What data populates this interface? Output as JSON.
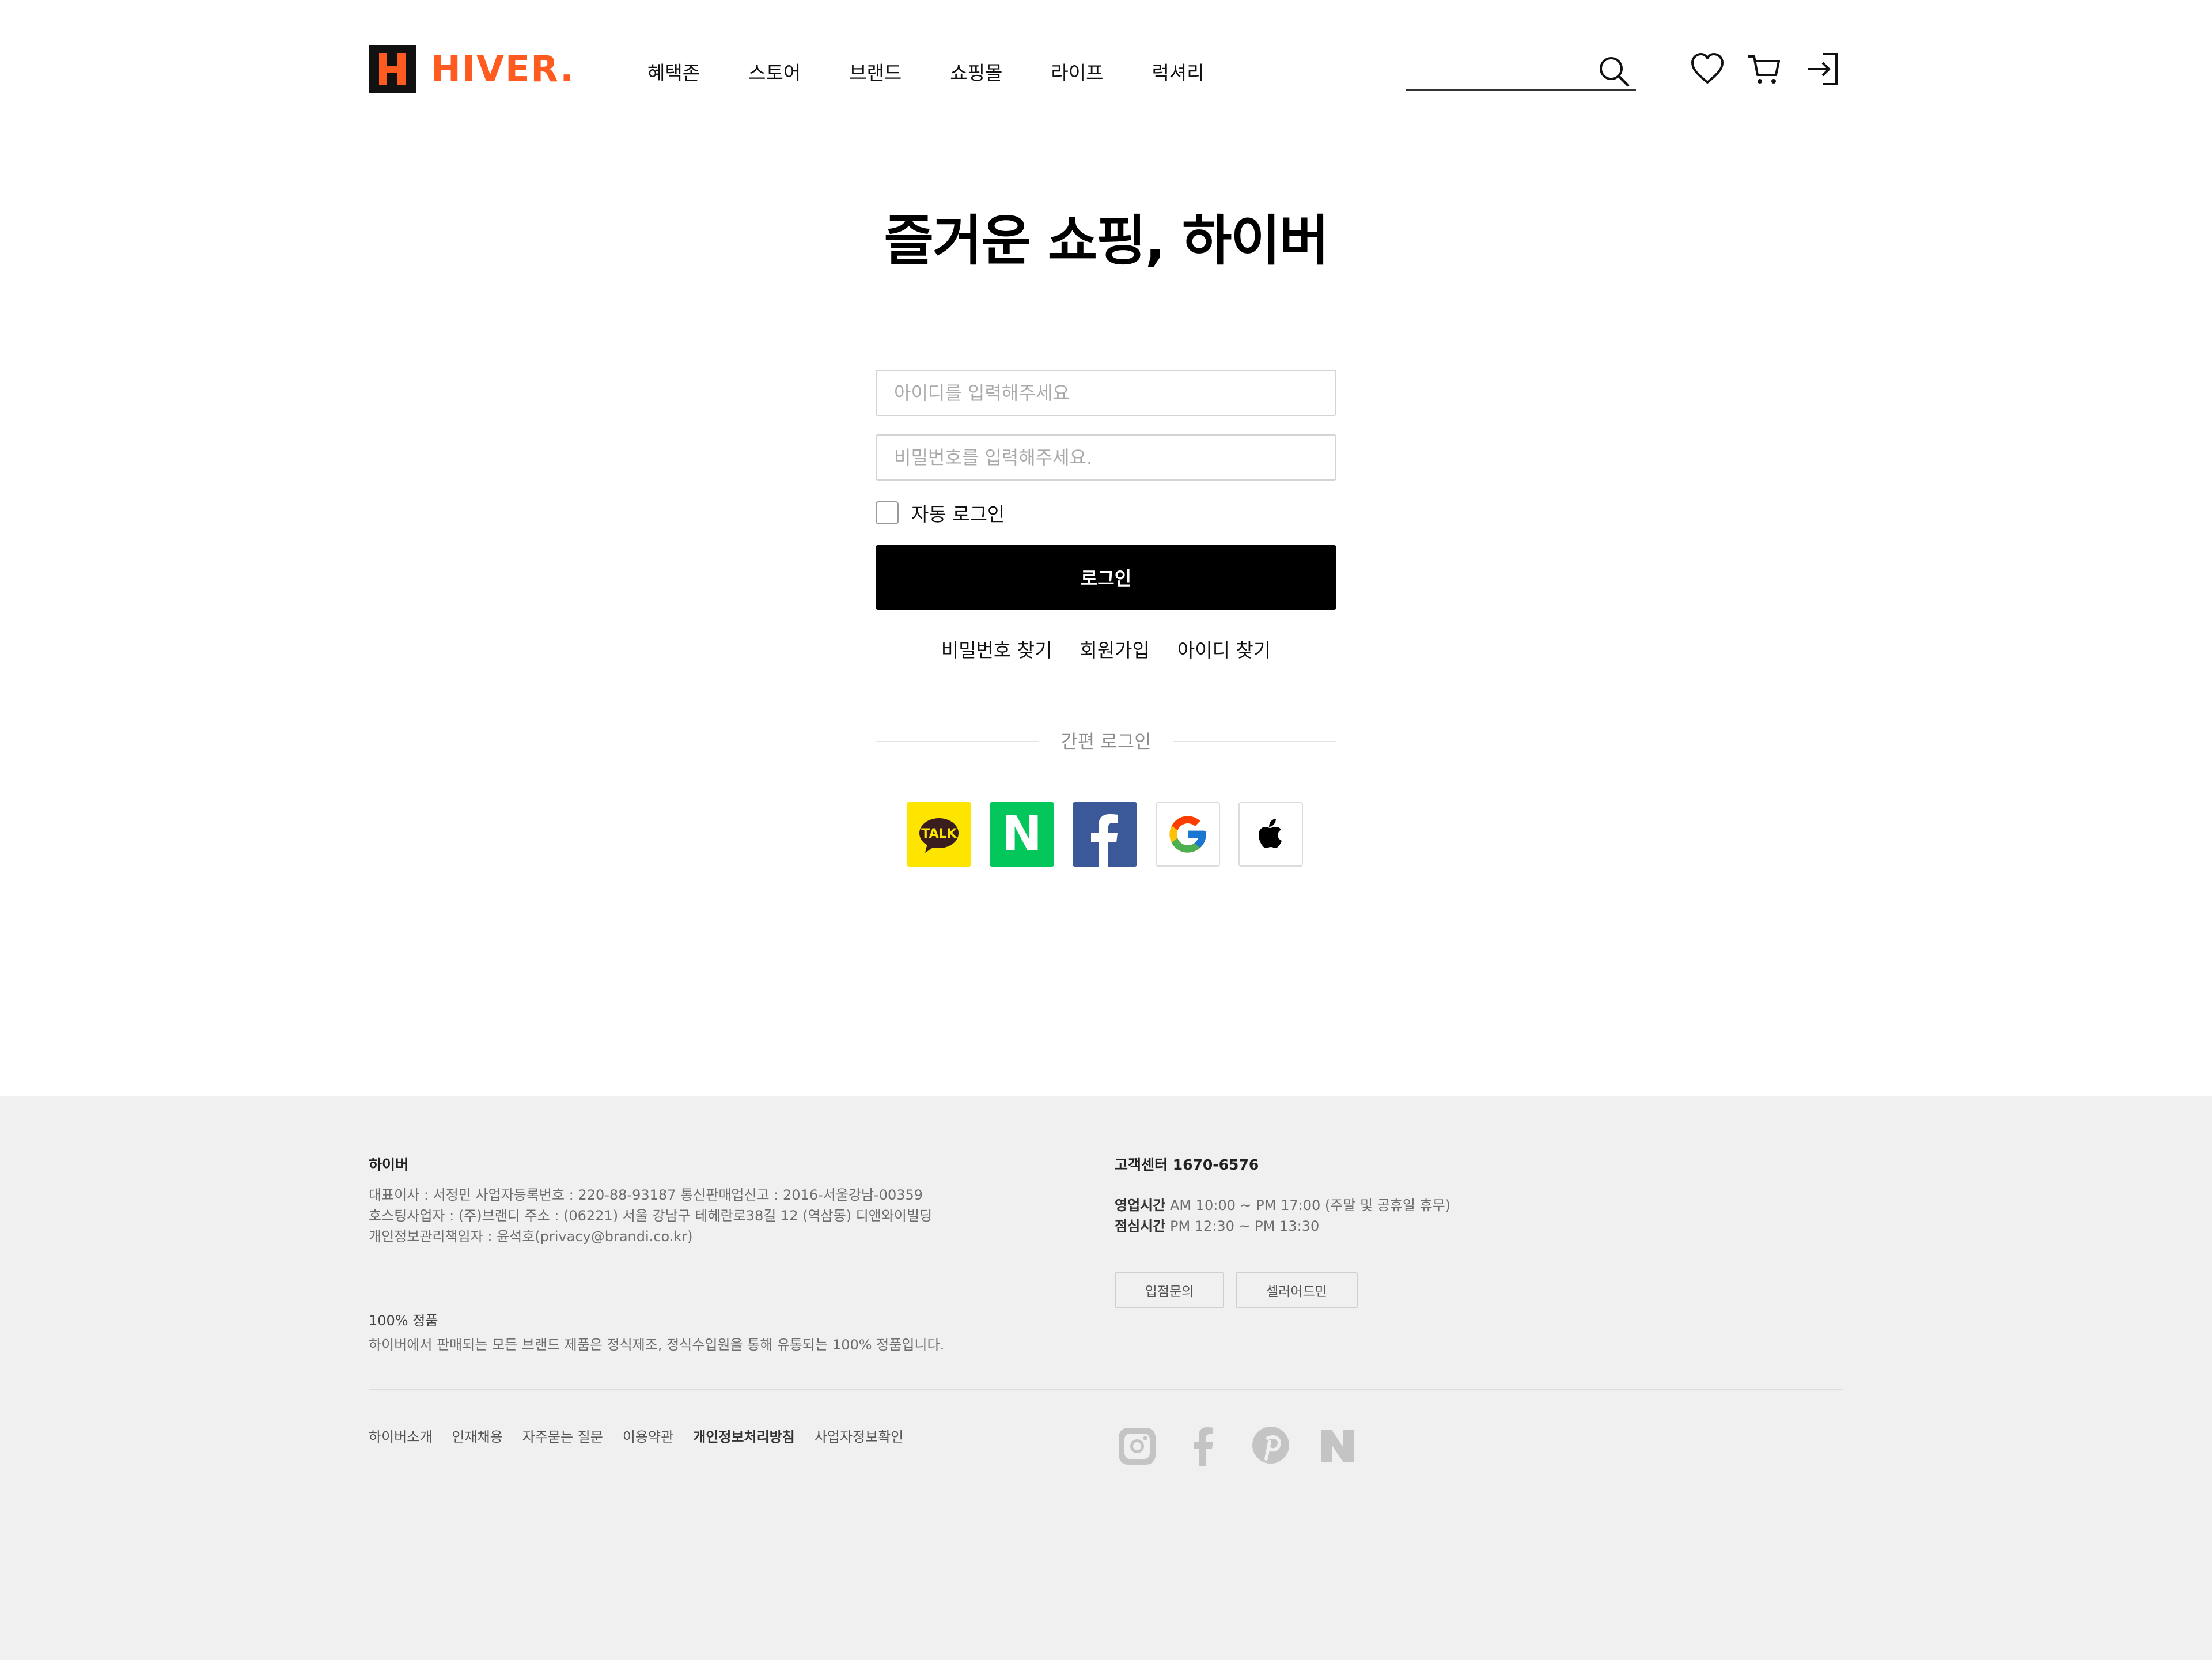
{
  "header": {
    "logo_text": "HIVER.",
    "nav": [
      "혜택존",
      "스토어",
      "브랜드",
      "쇼핑몰",
      "라이프",
      "럭셔리"
    ],
    "search_placeholder": "",
    "icons": [
      "search-icon",
      "heart-icon",
      "cart-icon",
      "login-icon"
    ]
  },
  "main": {
    "title": "즐거운 쇼핑, 하이버",
    "id_placeholder": "아이디를 입력해주세요",
    "pw_placeholder": "비밀번호를 입력해주세요.",
    "auto_login_label": "자동 로그인",
    "auto_login_checked": false,
    "login_button": "로그인",
    "links": [
      "비밀번호 찾기",
      "회원가입",
      "아이디 찾기"
    ],
    "simple_login_label": "간편 로그인",
    "kakao_badge": "TALK",
    "naver_letter": "N",
    "social": [
      "kakao-talk-icon",
      "naver-icon",
      "facebook-icon",
      "google-icon",
      "apple-icon"
    ],
    "colors": {
      "kakao": "#FEE500",
      "naver": "#03C75A",
      "facebook": "#3B5998"
    }
  },
  "footer": {
    "company": "하이버",
    "info_lines": [
      "대표이사 : 서정민 사업자등록번호 : 220-88-93187 통신판매업신고 : 2016-서울강남-00359",
      "호스팅사업자 : (주)브랜디 주소 : (06221) 서울 강남구 테헤란로38길 12 (역삼동) 디앤와이빌딩",
      "개인정보관리책임자 : 윤석호(privacy@brandi.co.kr)"
    ],
    "genuine_title": "100% 정품",
    "genuine_text": "하이버에서 판매되는 모든 브랜드 제품은 정식제조, 정식수입원을 통해 유통되는 100% 정품입니다.",
    "cs_center": "고객센터 1670-6576",
    "hours": [
      {
        "label": "영업시간",
        "value": "AM 10:00 ~ PM 17:00 (주말 및 공휴일 휴무)"
      },
      {
        "label": "점심시간",
        "value": "PM 12:30 ~ PM 13:30"
      }
    ],
    "buttons": [
      "입점문의",
      "셀러어드민"
    ],
    "links": [
      "하이버소개",
      "인재채용",
      "자주묻는 질문",
      "이용약관",
      "개인정보처리방침",
      "사업자정보확인"
    ],
    "sns": [
      "instagram-icon",
      "facebook-icon",
      "pinterest-icon",
      "naver-icon"
    ]
  },
  "brand_color": "#FF5A1F"
}
